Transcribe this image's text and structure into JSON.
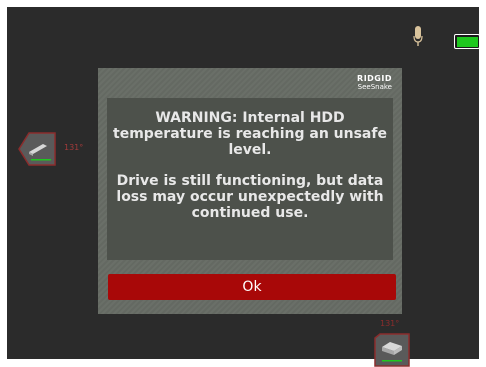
{
  "status_bar": {
    "microphone_icon": "microphone-icon",
    "battery_icon": "battery-icon",
    "battery_level": 1.0,
    "battery_color": "#1ec81e"
  },
  "indicators": {
    "left_temperature": "131°",
    "bottom_temperature": "131°",
    "accent_color": "#a03a3a"
  },
  "dialog": {
    "brand": "RIDGID",
    "product": "SeeSnake",
    "message_line1": "WARNING: Internal HDD temperature is reaching an unsafe level.",
    "message_line2": "Drive is still functioning, but data loss may occur unexpectedly with continued use.",
    "ok_label": "Ok",
    "button_color": "#a80808"
  }
}
